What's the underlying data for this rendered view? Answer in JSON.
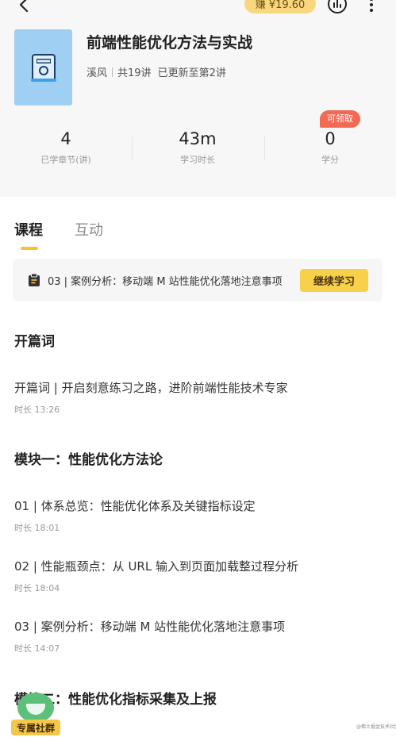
{
  "header": {
    "earn_label": "赚 ¥19.60",
    "course_title": "前端性能优化方法与实战",
    "author": "溪风",
    "lesson_count": "共19讲",
    "update_status": "已更新至第2讲"
  },
  "stats": [
    {
      "value": "4",
      "label": "已学章节(讲)"
    },
    {
      "value": "43m",
      "label": "学习时长"
    },
    {
      "value": "0",
      "label": "学分"
    }
  ],
  "claim_badge": "可领取",
  "tabs": {
    "course": "课程",
    "interact": "互动"
  },
  "continue": {
    "text": "03 | 案例分析：移动端 M 站性能优化落地注意事项",
    "button": "继续学习"
  },
  "sections": [
    {
      "title": "开篇词",
      "lessons": [
        {
          "name": "开篇词 | 开启刻意练习之路，进阶前端性能技术专家",
          "duration": "时长 13:26"
        }
      ]
    },
    {
      "title": "模块一：性能优化方法论",
      "lessons": [
        {
          "name": "01 | 体系总览：性能优化体系及关键指标设定",
          "duration": "时长 18:01"
        },
        {
          "name": "02 | 性能瓶颈点：从 URL 输入到页面加载整过程分析",
          "duration": "时长 18:04"
        },
        {
          "name": "03 | 案例分析：移动端 M 站性能优化落地注意事项",
          "duration": "时长 14:07"
        }
      ]
    },
    {
      "title": "模块二：性能优化指标采集及上报",
      "lessons": []
    }
  ],
  "community_label": "专属社群",
  "watermark": "@稀土掘金技术社区",
  "colors": {
    "accent": "#f8d14a",
    "badge": "#f26a54",
    "cover": "#9fd0f4",
    "community": "#5cc07a"
  }
}
